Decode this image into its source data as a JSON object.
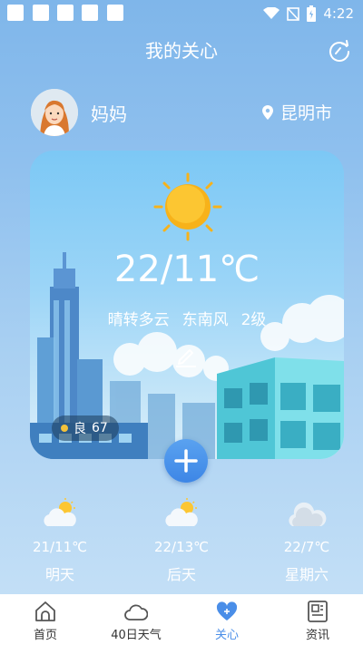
{
  "status_bar": {
    "time": "4:22"
  },
  "header": {
    "title": "我的关心"
  },
  "person": {
    "name": "妈妈",
    "location": "昆明市"
  },
  "card": {
    "temperature": "22/11℃",
    "weather": "晴转多云",
    "wind_dir": "东南风",
    "wind_level": "2级",
    "aqi_label": "良",
    "aqi_value": "67"
  },
  "forecast": [
    {
      "temp": "21/11℃",
      "day": "明天",
      "icon": "partly-cloudy-icon"
    },
    {
      "temp": "22/13℃",
      "day": "后天",
      "icon": "partly-cloudy-icon"
    },
    {
      "temp": "22/7℃",
      "day": "星期六",
      "icon": "cloudy-icon"
    }
  ],
  "nav": [
    {
      "label": "首页",
      "icon": "home-icon"
    },
    {
      "label": "40日天气",
      "icon": "cloud-icon"
    },
    {
      "label": "关心",
      "icon": "heart-icon"
    },
    {
      "label": "资讯",
      "icon": "news-icon"
    }
  ],
  "colors": {
    "accent": "#4a8ee8",
    "aqi_dot": "#f4c23a",
    "sun": "#f7b21a"
  }
}
